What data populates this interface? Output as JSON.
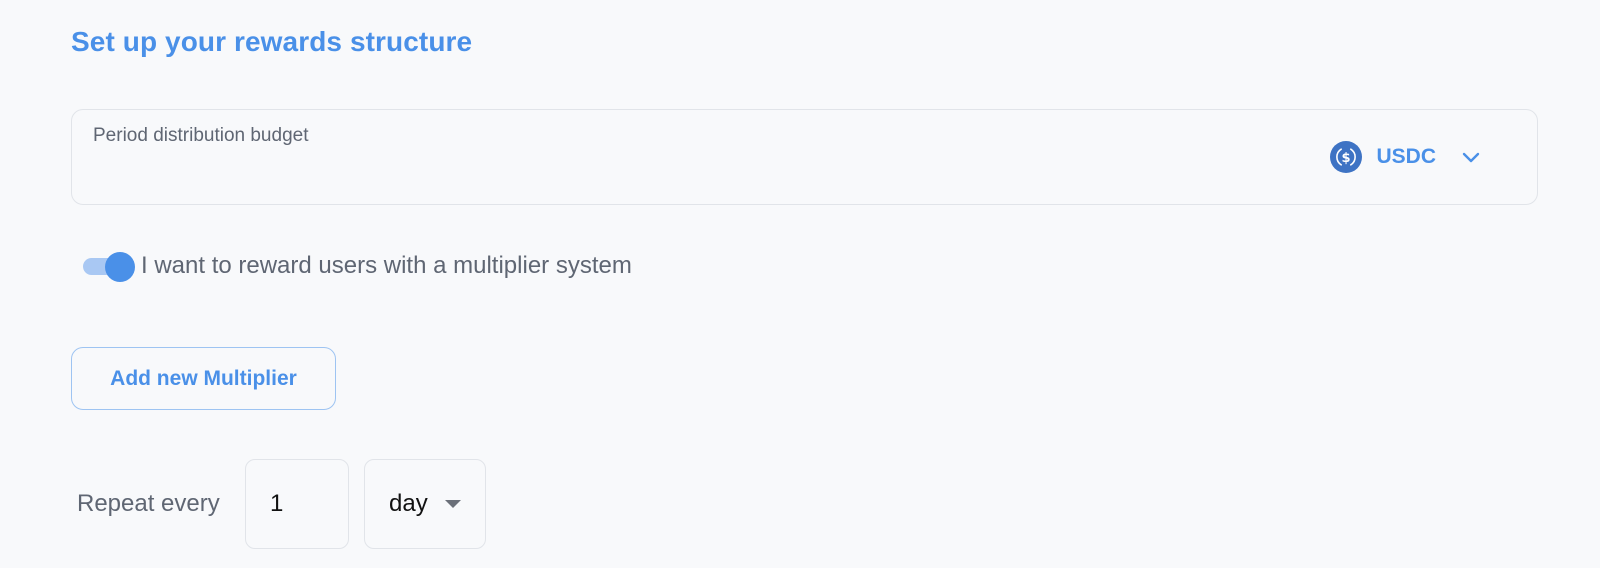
{
  "title": "Set up your rewards structure",
  "budget": {
    "label": "Period distribution budget",
    "token": "USDC",
    "token_icon": "usdc-coin-icon",
    "chevron_icon": "chevron-down-icon"
  },
  "multiplier_toggle": {
    "checked": true,
    "label": "I want to reward users with a multiplier system"
  },
  "add_multiplier_button": "Add new Multiplier",
  "repeat": {
    "label": "Repeat every",
    "value": "1",
    "unit": "day",
    "unit_icon": "caret-down-icon"
  },
  "colors": {
    "accent": "#4a90e8",
    "text": "#5f6673",
    "border": "#e1e4e9",
    "background": "#f8f9fb"
  }
}
